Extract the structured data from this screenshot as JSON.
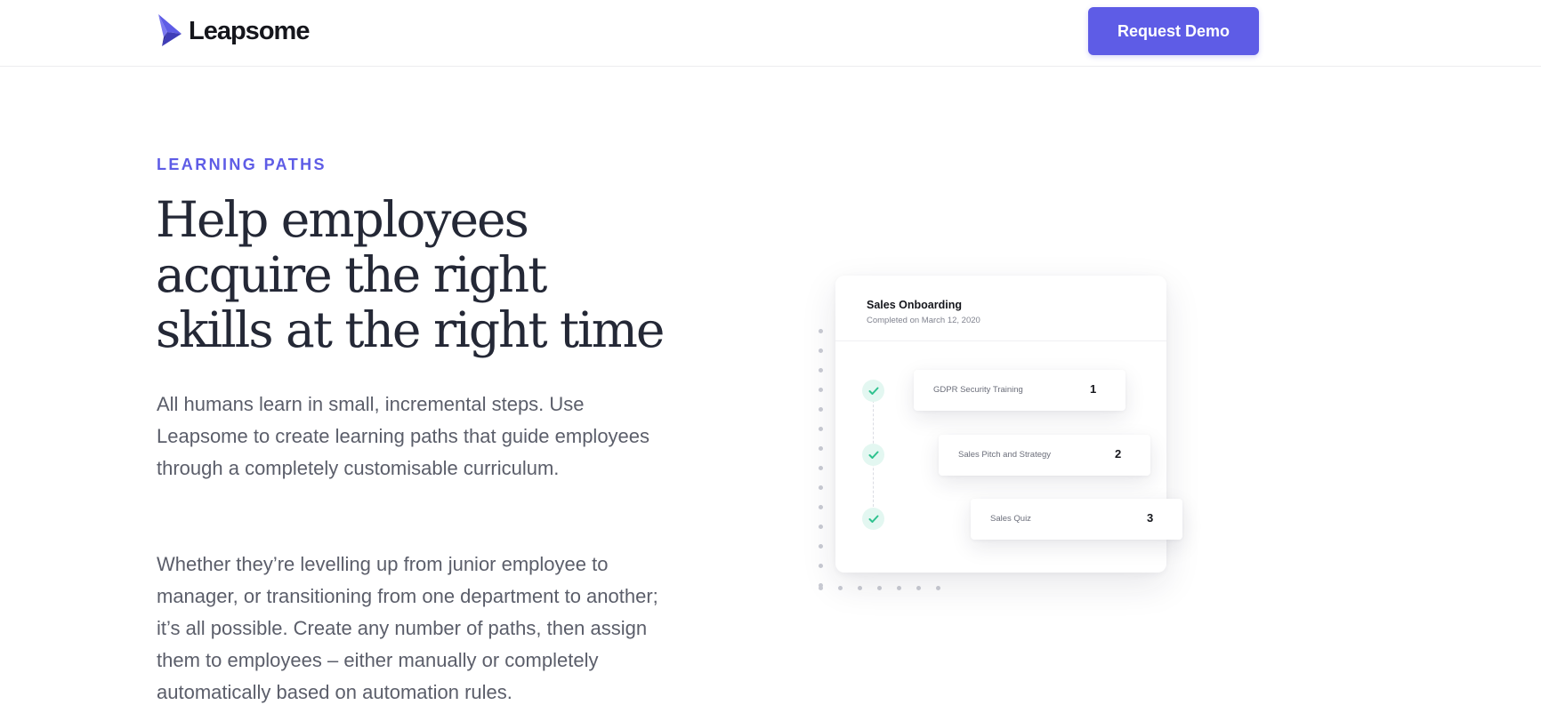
{
  "header": {
    "logo_text": "Leapsome",
    "cta_label": "Request Demo"
  },
  "hero": {
    "eyebrow": "LEARNING PATHS",
    "headline": "Help employees acquire the right skills at the right time",
    "paragraph_1": "All humans learn in small, incremental steps. Use Leapsome to create learning paths that guide employees through a completely customisable curriculum.",
    "paragraph_2": "Whether they’re levelling up from junior employee to manager, or transitioning from one department to another; it’s all possible. Create any number of paths, then assign them to employees – either manually or completely automatically based on automation rules."
  },
  "illustration": {
    "card_title": "Sales Onboarding",
    "card_subtitle": "Completed on March 12, 2020",
    "steps": [
      {
        "label": "GDPR Security Training",
        "number": "1",
        "status": "completed"
      },
      {
        "label": "Sales Pitch and Strategy",
        "number": "2",
        "status": "completed"
      },
      {
        "label": "Sales Quiz",
        "number": "3",
        "status": "completed"
      }
    ]
  },
  "colors": {
    "brand": "#5e5ce6",
    "headline": "#242836",
    "body_text": "#5b5e6a",
    "check_bg": "#e3f7f1",
    "check_mark": "#2fc28f"
  },
  "icons": {
    "logo": "leapsome-bird-icon",
    "check": "check-icon"
  }
}
